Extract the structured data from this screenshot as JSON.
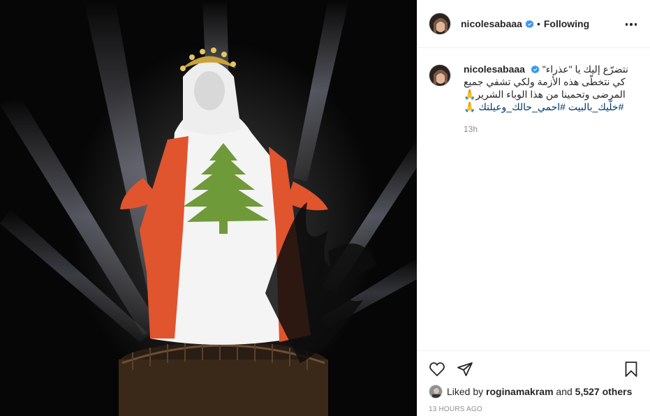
{
  "post": {
    "username": "nicolesabaaa",
    "separator": "•",
    "follow_status": "Following",
    "caption_lines": [
      "نتضرّع إليك يا \"عذراء\"",
      "كي نتخطّى هذه الأزمة ولكي تشفي جميع",
      "المرضى وتحمينا من هذا الوباء الشرير🙏"
    ],
    "hashtags": "#خلّيك_بالبيت #احمي_حالك_وعيلتك 🙏",
    "caption_time": "13h",
    "liked_by_prefix": "Liked by",
    "liked_by_user": "roginamakram",
    "liked_by_and": "and",
    "likes_others": "5,527 others",
    "timestamp": "13 HOURS AGO"
  },
  "icons": {
    "verified": "verified-badge-icon",
    "more": "more-options-icon",
    "like": "heart-icon",
    "share": "paper-plane-icon",
    "save": "bookmark-icon"
  },
  "colors": {
    "verified": "#3897f0",
    "hashtag": "#00376b",
    "muted": "#8e8e8e",
    "flag_red": "#e0542e",
    "cedar_green": "#6f9a3a"
  }
}
